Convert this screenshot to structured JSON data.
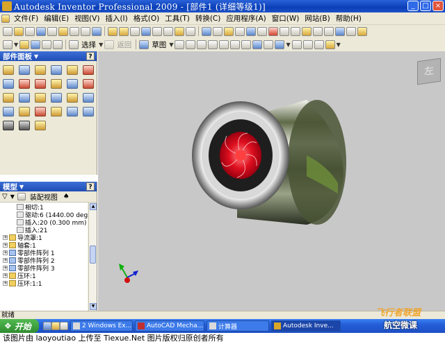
{
  "window": {
    "title": "Autodesk Inventor Professional 2009 - [部件1 (详细等级1)]",
    "buttons": [
      "_",
      "□",
      "×"
    ]
  },
  "menu": [
    "文件(F)",
    "编辑(E)",
    "视图(V)",
    "插入(I)",
    "格式(O)",
    "工具(T)",
    "转换(C)",
    "应用程序(A)",
    "窗口(W)",
    "网站(B)",
    "帮助(H)"
  ],
  "toolbar2": {
    "select_label": "选择",
    "back_label": "返回",
    "sketch_label": "草图"
  },
  "panel": {
    "title": "部件面板",
    "help": "?"
  },
  "model": {
    "title": "模型",
    "help": "?",
    "view_dropdown": "装配视图",
    "tree": [
      {
        "label": "相切:1"
      },
      {
        "label": "驱动:6 (1440.00 deg)"
      },
      {
        "label": "插入:20 (0.300 mm)"
      },
      {
        "label": "插入:21"
      },
      {
        "label": "导流罩:1"
      },
      {
        "label": "轴套:1"
      },
      {
        "label": "零部件阵列 1"
      },
      {
        "label": "零部件阵列 2"
      },
      {
        "label": "零部件阵列 3"
      },
      {
        "label": "压环:1"
      },
      {
        "label": "压环:1:1"
      }
    ]
  },
  "viewcube": {
    "face_label": "左"
  },
  "status": {
    "text": "就绪"
  },
  "taskbar": {
    "start_label": "开始",
    "tasks": [
      "2 Windows Ex...",
      "AutoCAD Mecha...",
      "计算器",
      "Autodesk Inve..."
    ]
  },
  "watermark": {
    "brand": "飞行者联盟",
    "channel": "航空微课"
  },
  "caption": "该图片由 laoyoutiao 上传至 Tiexue.Net 图片版权归原创者所有",
  "colors": {
    "title_blue": "#0a3fb8",
    "viewport_bg": "#c8c8c8",
    "impeller_red": "#e01020",
    "taskbar_blue": "#245ed8"
  }
}
